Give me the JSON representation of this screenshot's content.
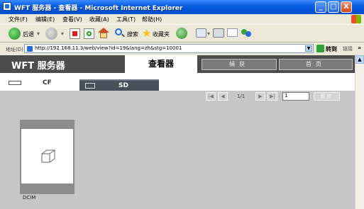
{
  "window": {
    "title": "WFT 服务器 - 查看器 - Microsoft Internet Explorer",
    "controls": {
      "minimize": "_",
      "maximize": "□",
      "close": "X"
    }
  },
  "menu": [
    "文件(F)",
    "编辑(E)",
    "查看(V)",
    "收藏(A)",
    "工具(T)",
    "帮助(H)"
  ],
  "toolbar": {
    "back_label": "后退",
    "search_label": "搜索",
    "favorites_label": "收藏夹"
  },
  "address": {
    "label": "地址(D)",
    "url": "http://192.168.11.3/web/view?id=19&lang=zh&stg=10001",
    "go_label": "转到",
    "links_label": "链接",
    "more": "»"
  },
  "app": {
    "brand": "WFT 服务器",
    "nav": {
      "viewer": "查看器",
      "capture": "捕获",
      "home": "首页"
    },
    "storage_tabs": {
      "cf": "CF",
      "sd": "SD"
    },
    "pager": {
      "first": "|◀",
      "prev": "◀",
      "count": "1/1",
      "next": "▶",
      "last": "▶|",
      "page_value": "1",
      "go_label": "跳转"
    },
    "folder": {
      "name": "DCIM"
    }
  },
  "colors": {
    "titlebar": "#0a5fe0",
    "header": "#4c4c4c",
    "content_bg": "#c6c6c6",
    "active_tab": "#46505a",
    "folder_frame": "#8c8c8c"
  },
  "icons": [
    "ie-icon",
    "back-icon",
    "forward-icon",
    "stop-icon",
    "refresh-icon",
    "home-icon",
    "search-icon",
    "favorites-icon",
    "history-icon",
    "mail-icon",
    "print-icon",
    "messenger-icon",
    "go-icon",
    "windows-logo-icon",
    "cf-card-icon",
    "sd-card-icon",
    "folder-icon"
  ]
}
